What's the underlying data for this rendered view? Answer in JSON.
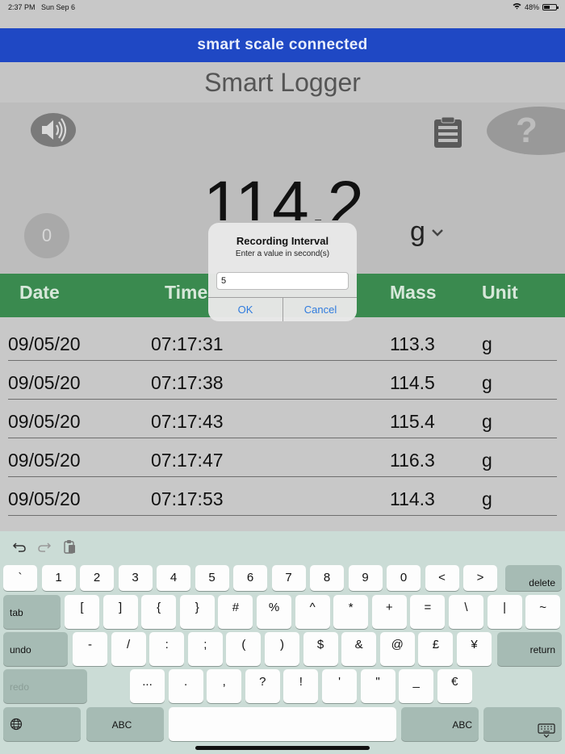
{
  "status_bar": {
    "time": "2:37 PM",
    "date": "Sun Sep 6",
    "battery": "48%"
  },
  "banner": "smart scale connected",
  "app_title": "Smart Logger",
  "reading": {
    "value": "114.2",
    "unit": "g",
    "zero_label": "0",
    "help_label": "?"
  },
  "table": {
    "headers": {
      "date": "Date",
      "time": "Time",
      "mass": "Mass",
      "unit": "Unit"
    },
    "rows": [
      {
        "date": "09/05/20",
        "time": "07:17:31",
        "mass": "113.3",
        "unit": "g"
      },
      {
        "date": "09/05/20",
        "time": "07:17:38",
        "mass": "114.5",
        "unit": "g"
      },
      {
        "date": "09/05/20",
        "time": "07:17:43",
        "mass": "115.4",
        "unit": "g"
      },
      {
        "date": "09/05/20",
        "time": "07:17:47",
        "mass": "116.3",
        "unit": "g"
      },
      {
        "date": "09/05/20",
        "time": "07:17:53",
        "mass": "114.3",
        "unit": "g"
      }
    ]
  },
  "dialog": {
    "title": "Recording Interval",
    "message": "Enter a value in second(s)",
    "input_value": "5",
    "ok_label": "OK",
    "cancel_label": "Cancel"
  },
  "keyboard": {
    "row1": [
      "`",
      "1",
      "2",
      "3",
      "4",
      "5",
      "6",
      "7",
      "8",
      "9",
      "0",
      "<",
      ">"
    ],
    "delete_label": "delete",
    "tab_label": "tab",
    "row2": [
      "[",
      "]",
      "{",
      "}",
      "#",
      "%",
      "^",
      "*",
      "+",
      "=",
      "\\",
      "|",
      "~"
    ],
    "undo_label": "undo",
    "row3": [
      "-",
      "/",
      ":",
      ";",
      "(",
      ")",
      "$",
      "&",
      "@",
      "£",
      "¥"
    ],
    "return_label": "return",
    "redo_label": "redo",
    "row4": [
      "...",
      ".",
      ",",
      "?",
      "!",
      "'",
      "\"",
      "_",
      "€"
    ],
    "abc_label": "ABC",
    "icons": [
      "undo-arrow-icon",
      "redo-arrow-icon",
      "clipboard-paste-icon",
      "globe-icon",
      "keyboard-dismiss-icon"
    ]
  }
}
